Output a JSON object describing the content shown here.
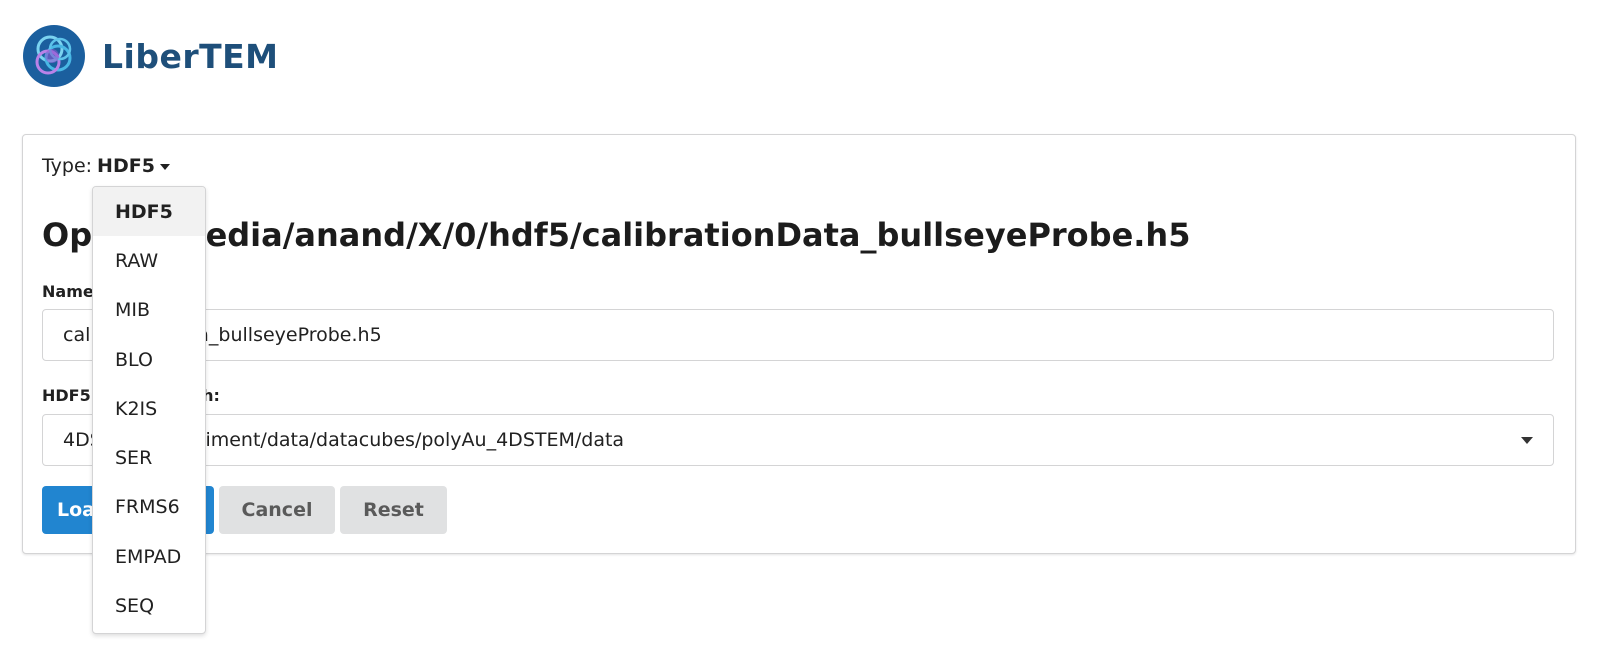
{
  "app": {
    "name": "LiberTEM"
  },
  "type_selector": {
    "label": "Type:",
    "value": "HDF5"
  },
  "title": "Open: /media/anand/X/0/hdf5/calibrationData_bullseyeProbe.h5",
  "name_field": {
    "label": "Name:",
    "value": "calibrationData_bullseyeProbe.h5"
  },
  "hdf5_field": {
    "label": "HDF5 Dataset Path:",
    "value": "4DSTEM_experiment/data/datacubes/polyAu_4DSTEM/data"
  },
  "buttons": {
    "load": "Load Dataset",
    "cancel": "Cancel",
    "reset": "Reset"
  },
  "dropdown": {
    "selected": "HDF5",
    "options": [
      "HDF5",
      "RAW",
      "MIB",
      "BLO",
      "K2IS",
      "SER",
      "FRMS6",
      "EMPAD",
      "SEQ"
    ]
  },
  "colors": {
    "primary": "#2185d0",
    "secondary": "#e0e1e2",
    "brand_text": "#1e4f7a"
  }
}
